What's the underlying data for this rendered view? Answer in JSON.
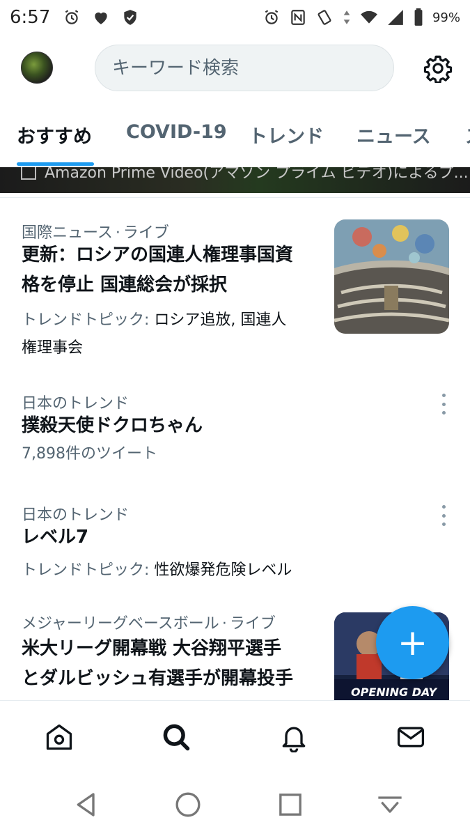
{
  "status_bar": {
    "time": "6:57",
    "battery": "99%",
    "icons_left": [
      "alarm-icon",
      "heart-icon",
      "shield-check-icon"
    ],
    "icons_right": [
      "alarm-icon",
      "nfc-icon",
      "vibrate-icon",
      "data-arrows-icon",
      "wifi-icon",
      "signal-icon",
      "battery-icon"
    ]
  },
  "header": {
    "search_placeholder": "キーワード検索",
    "settings_icon": "gear-icon",
    "avatar_icon": "avatar"
  },
  "tabs": [
    {
      "label": "おすすめ",
      "active": true
    },
    {
      "label": "COVID-19",
      "active": false
    },
    {
      "label": "トレンド",
      "active": false
    },
    {
      "label": "ニュース",
      "active": false
    },
    {
      "label": "ス",
      "active": false
    }
  ],
  "banner": {
    "text": "Amazon Prime Video(アマゾン プライム ビデオ)によるプ..."
  },
  "trends": [
    {
      "category": "国際ニュース",
      "sep": "·",
      "live": "ライブ",
      "title_line1": "更新：ロシアの国連人権理事国資",
      "title_line2": "格を停止 国連総会が採択",
      "topics_label": "トレンドトピック: ",
      "topics_line1": "ロシア追放, 国連人",
      "topics_line2": "権理事会",
      "thumb": "un-assembly-hall-photo"
    },
    {
      "category": "日本のトレンド",
      "title": "撲殺天使ドクロちゃん",
      "count": "7,898件のツイート",
      "more_icon": "more-vertical-icon"
    },
    {
      "category": "日本のトレンド",
      "title": "レベル7",
      "topics_label": "トレンドトピック: ",
      "topics": "性欲爆発危険レベル",
      "more_icon": "more-vertical-icon"
    },
    {
      "category": "メジャーリーグベースボール",
      "sep": "·",
      "live": "ライブ",
      "title_line1": "米大リーグ開幕戦 大谷翔平選手",
      "title_line2": "とダルビッシュ有選手が開幕投手",
      "thumb_text": "OPENING DAY",
      "thumb": "mlb-opening-day-photo"
    }
  ],
  "fab": {
    "label": "+",
    "icon": "compose-plus-icon"
  },
  "bottom_nav": [
    "home-icon",
    "search-icon",
    "bell-icon",
    "mail-icon"
  ],
  "system_nav": [
    "back-icon",
    "home-circle-icon",
    "recents-icon",
    "keyboard-hide-icon"
  ],
  "colors": {
    "accent": "#1d9bf0",
    "secondary_text": "#536471",
    "primary_text": "#0f1419"
  }
}
